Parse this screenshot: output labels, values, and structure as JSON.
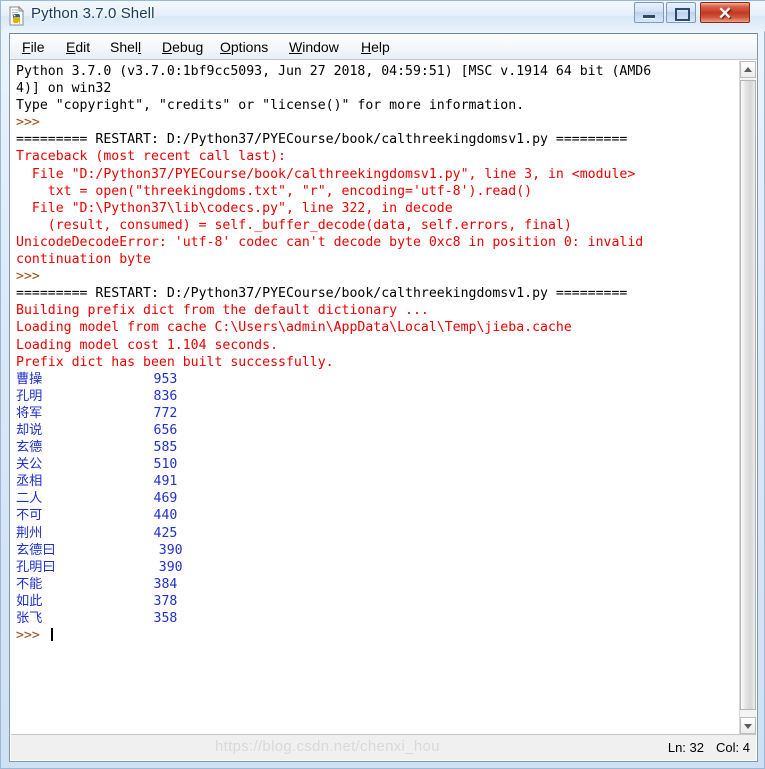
{
  "window": {
    "title": "Python 3.7.0 Shell",
    "icon": "python-idle-icon",
    "caption_buttons": {
      "minimize": "minimize",
      "maximize": "maximize",
      "close": "✕"
    }
  },
  "menubar": {
    "items": [
      {
        "label": "File",
        "pre": "",
        "mnemonic": "F",
        "post": "ile"
      },
      {
        "label": "Edit",
        "pre": "",
        "mnemonic": "E",
        "post": "dit"
      },
      {
        "label": "Shell",
        "pre": "Shel",
        "mnemonic": "l",
        "post": ""
      },
      {
        "label": "Debug",
        "pre": "",
        "mnemonic": "D",
        "post": "ebug"
      },
      {
        "label": "Options",
        "pre": "",
        "mnemonic": "O",
        "post": "ptions"
      },
      {
        "label": "Window",
        "pre": "",
        "mnemonic": "W",
        "post": "indow"
      },
      {
        "label": "Help",
        "pre": "",
        "mnemonic": "H",
        "post": "elp"
      }
    ]
  },
  "shell": {
    "lines": [
      {
        "color": "black",
        "text": "Python 3.7.0 (v3.7.0:1bf9cc5093, Jun 27 2018, 04:59:51) [MSC v.1914 64 bit (AMD6"
      },
      {
        "color": "black",
        "text": "4)] on win32"
      },
      {
        "color": "black",
        "text": "Type \"copyright\", \"credits\" or \"license()\" for more information."
      },
      {
        "color": "prompt",
        "text": ">>> "
      },
      {
        "color": "black",
        "text": "========= RESTART: D:/Python37/PYECourse/book/calthreekingdomsv1.py ========="
      },
      {
        "color": "red",
        "text": "Traceback (most recent call last):"
      },
      {
        "color": "red",
        "text": "  File \"D:/Python37/PYECourse/book/calthreekingdomsv1.py\", line 3, in <module>"
      },
      {
        "color": "red",
        "text": "    txt = open(\"threekingdoms.txt\", \"r\", encoding='utf-8').read()"
      },
      {
        "color": "red",
        "text": "  File \"D:\\Python37\\lib\\codecs.py\", line 322, in decode"
      },
      {
        "color": "red",
        "text": "    (result, consumed) = self._buffer_decode(data, self.errors, final)"
      },
      {
        "color": "red",
        "text": "UnicodeDecodeError: 'utf-8' codec can't decode byte 0xc8 in position 0: invalid"
      },
      {
        "color": "red",
        "text": "continuation byte"
      },
      {
        "color": "prompt",
        "text": ">>> "
      },
      {
        "color": "black",
        "text": "========= RESTART: D:/Python37/PYECourse/book/calthreekingdomsv1.py ========="
      },
      {
        "color": "red",
        "text": "Building prefix dict from the default dictionary ..."
      },
      {
        "color": "red",
        "text": "Loading model from cache C:\\Users\\admin\\AppData\\Local\\Temp\\jieba.cache"
      },
      {
        "color": "red",
        "text": "Loading model cost 1.104 seconds."
      },
      {
        "color": "red",
        "text": "Prefix dict has been built successfully."
      },
      {
        "color": "blue",
        "text": "曹操              953"
      },
      {
        "color": "blue",
        "text": "孔明              836"
      },
      {
        "color": "blue",
        "text": "将军              772"
      },
      {
        "color": "blue",
        "text": "却说              656"
      },
      {
        "color": "blue",
        "text": "玄德              585"
      },
      {
        "color": "blue",
        "text": "关公              510"
      },
      {
        "color": "blue",
        "text": "丞相              491"
      },
      {
        "color": "blue",
        "text": "二人              469"
      },
      {
        "color": "blue",
        "text": "不可              440"
      },
      {
        "color": "blue",
        "text": "荆州              425"
      },
      {
        "color": "blue",
        "text": "玄德曰             390"
      },
      {
        "color": "blue",
        "text": "孔明曰             390"
      },
      {
        "color": "blue",
        "text": "不能              384"
      },
      {
        "color": "blue",
        "text": "如此              378"
      },
      {
        "color": "blue",
        "text": "张飞              358"
      },
      {
        "color": "prompt",
        "text": ">>> ",
        "caret": true
      }
    ],
    "word_counts": [
      {
        "word": "曹操",
        "count": 953
      },
      {
        "word": "孔明",
        "count": 836
      },
      {
        "word": "将军",
        "count": 772
      },
      {
        "word": "却说",
        "count": 656
      },
      {
        "word": "玄德",
        "count": 585
      },
      {
        "word": "关公",
        "count": 510
      },
      {
        "word": "丞相",
        "count": 491
      },
      {
        "word": "二人",
        "count": 469
      },
      {
        "word": "不可",
        "count": 440
      },
      {
        "word": "荆州",
        "count": 425
      },
      {
        "word": "玄德曰",
        "count": 390
      },
      {
        "word": "孔明曰",
        "count": 390
      },
      {
        "word": "不能",
        "count": 384
      },
      {
        "word": "如此",
        "count": 378
      },
      {
        "word": "张飞",
        "count": 358
      }
    ]
  },
  "statusbar": {
    "line_label": "Ln: 32",
    "col_label": "Col: 4",
    "watermark": "https://blog.csdn.net/chenxi_hou"
  },
  "colors": {
    "stdout_black": "#000000",
    "stderr_red": "#ee0000",
    "output_blue": "#1f30d0",
    "prompt_brown": "#9c4a18",
    "close_button_red": "#c03a22",
    "frame_blue": "#cfe0f3"
  }
}
